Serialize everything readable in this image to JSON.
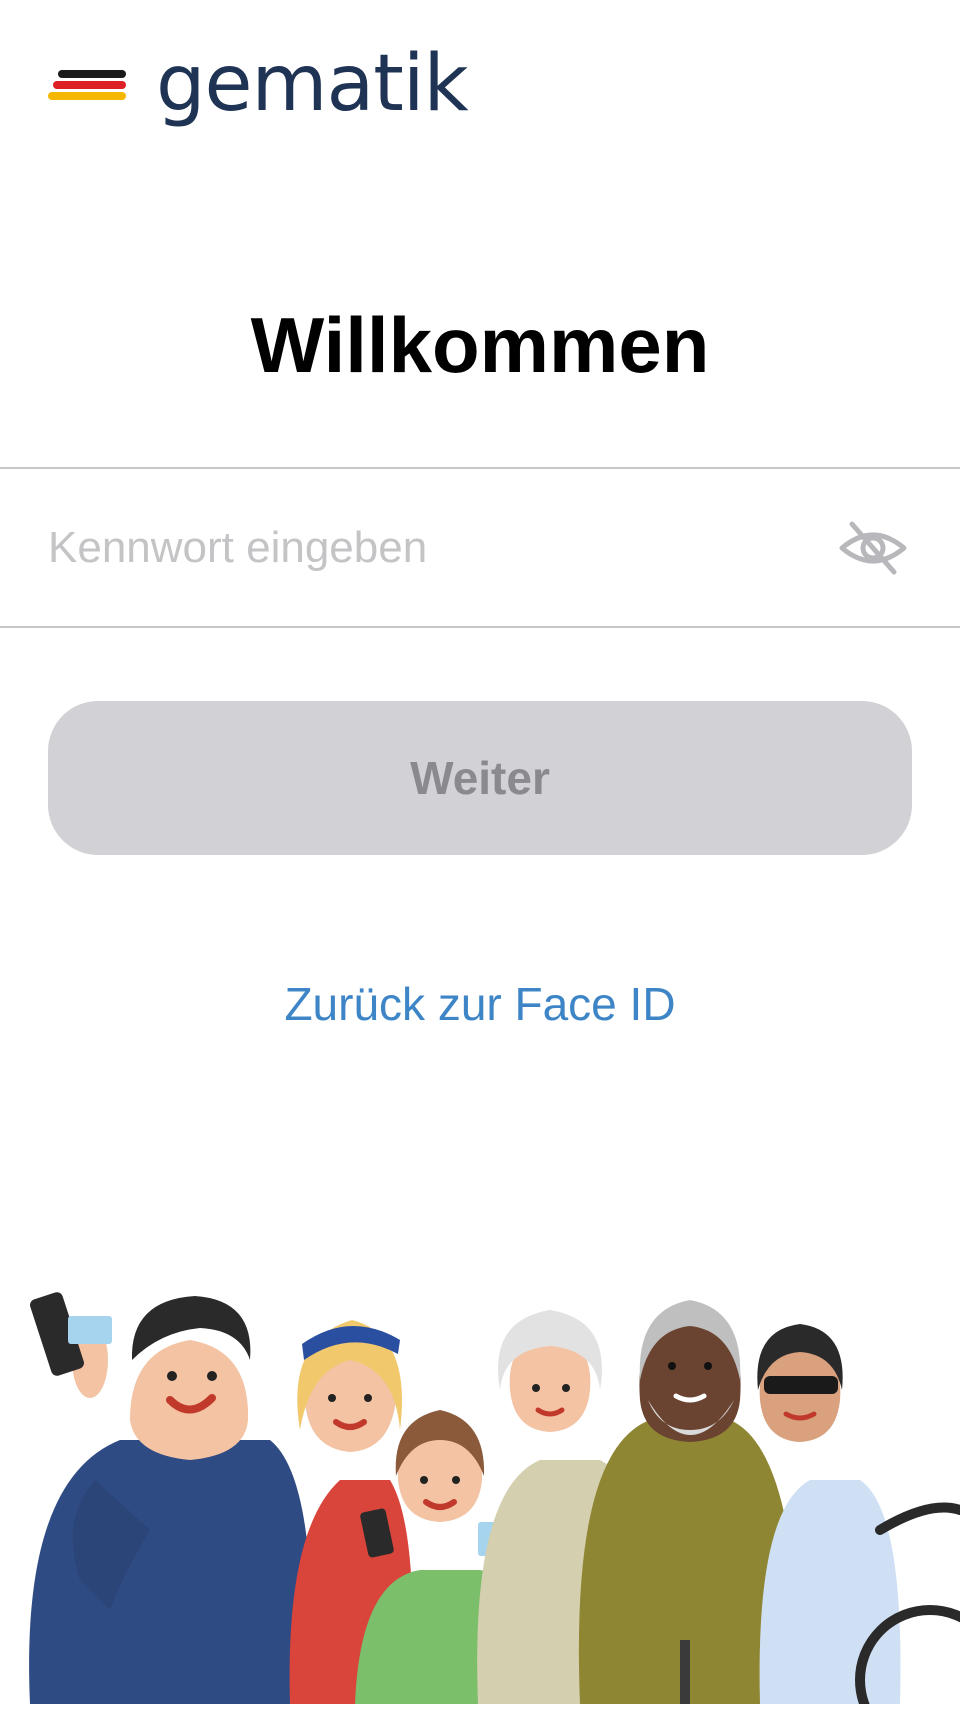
{
  "logo": {
    "wordmark": "gematik",
    "flag_colors": [
      "#1a1a1a",
      "#dd1f26",
      "#f5b700"
    ]
  },
  "title": "Willkommen",
  "password_field": {
    "placeholder": "Kennwort eingeben",
    "value": "",
    "visibility_icon": "eye-slash-icon"
  },
  "continue_button": {
    "label": "Weiter",
    "enabled": false
  },
  "face_id_link": {
    "label": "Zurück zur Face ID"
  },
  "colors": {
    "brand": "#1f3354",
    "link": "#3d85c6",
    "button_disabled_bg": "#d1d1d6",
    "button_disabled_text": "#8a8a8e",
    "divider": "#c8c8cc",
    "placeholder": "#c4c4c7"
  },
  "illustration": {
    "description_icon": "people-group-illustration"
  }
}
